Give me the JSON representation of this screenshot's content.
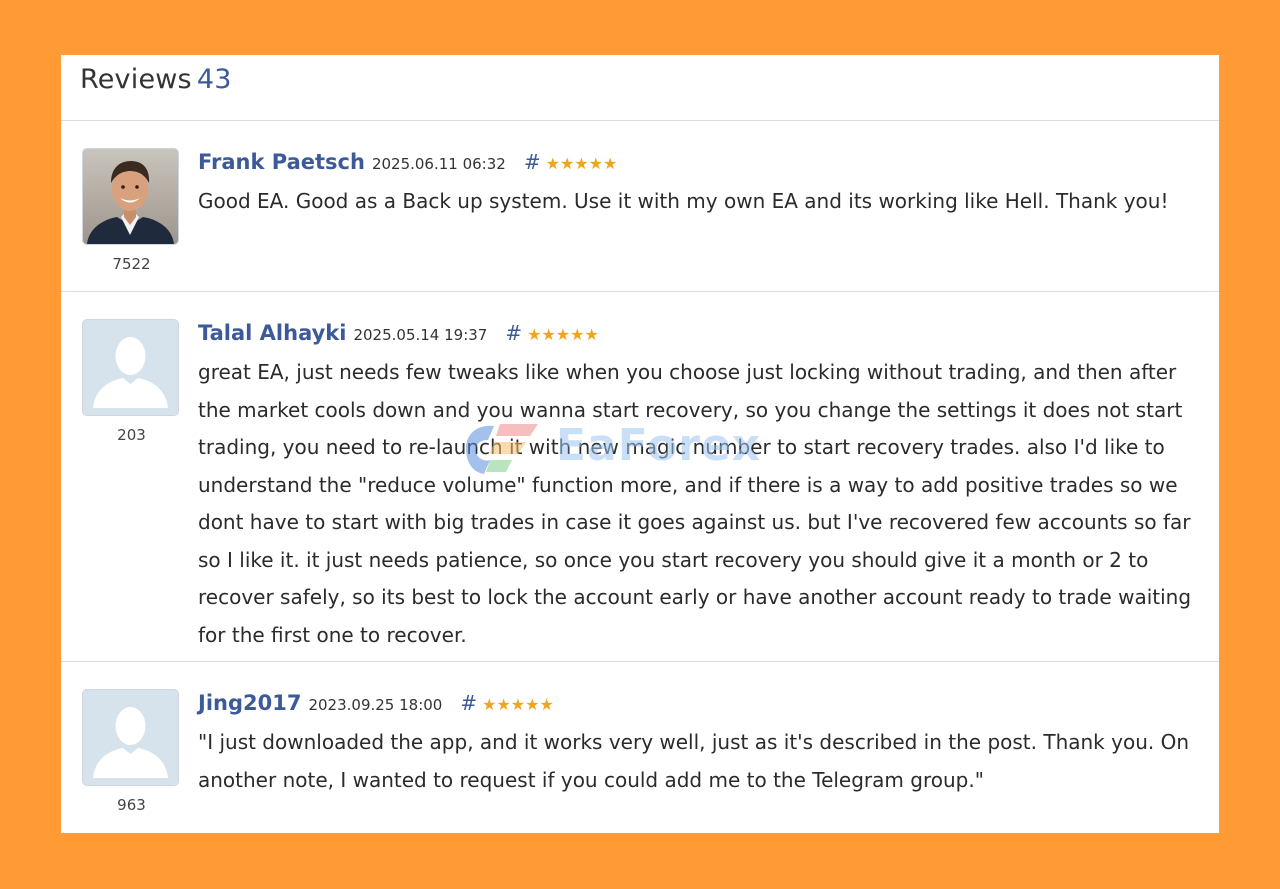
{
  "colors": {
    "background": "#ff9a35",
    "author_link": "#3c5a99",
    "star": "#f0a51e"
  },
  "header": {
    "title": "Reviews",
    "count": "43"
  },
  "watermark": {
    "text": "EaForex"
  },
  "reviews": [
    {
      "author": "Frank Paetsch",
      "date": "2025.06.11 06:32",
      "hash": "#",
      "stars": "★★★★★",
      "rating_value": 5,
      "avatar": "photo-avatar",
      "count": "7522",
      "text": "Good EA. Good as a Back up system. Use it with my own EA and its working like Hell. Thank you!"
    },
    {
      "author": "Talal Alhayki",
      "date": "2025.05.14 19:37",
      "hash": "#",
      "stars": "★★★★★",
      "rating_value": 5,
      "avatar": "default-user-avatar",
      "count": "203",
      "text": "great EA, just needs few tweaks like when you choose just locking without trading, and then after the market cools down and you wanna start recovery, so you change the settings it does not start trading, you need to re-launch it with new magic number to start recovery trades. also I'd like to understand the \"reduce volume\" function more, and if there is a way to add positive trades so we dont have to start with big trades in case it goes against us. but I've recovered few accounts so far so I like it. it just needs patience, so once you start recovery you should give it a month or 2 to recover safely, so its best to lock the account early or have another account ready to trade waiting for the first one to recover."
    },
    {
      "author": "Jing2017",
      "date": "2023.09.25 18:00",
      "hash": "#",
      "stars": "★★★★★",
      "rating_value": 5,
      "avatar": "default-user-avatar",
      "count": "963",
      "text": "\"I just downloaded the app, and it works very well, just as it's described in the post. Thank you. On another note, I wanted to request if you could add me to the Telegram group.\""
    }
  ]
}
